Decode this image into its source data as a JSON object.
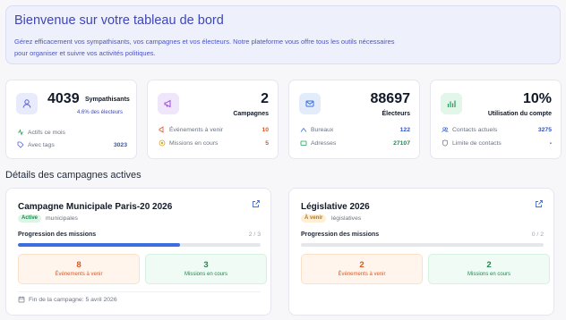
{
  "welcome": {
    "title": "Bienvenue sur votre tableau de bord",
    "description": "Gérez efficacement vos sympathisants, vos campagnes et vos électeurs. Notre plateforme vous offre tous les outils nécessaires pour organiser et suivre vos activités politiques."
  },
  "stats": {
    "supporters": {
      "value": "4039",
      "label": "Sympathisants",
      "note": "4.6% des électeurs",
      "icon": "user-icon",
      "rows": [
        {
          "label": "Actifs ce mois",
          "value": ""
        },
        {
          "label": "Avec tags",
          "value": "3023"
        }
      ]
    },
    "campaigns": {
      "value": "2",
      "label": "Campagnes",
      "icon": "megaphone-icon",
      "rows": [
        {
          "label": "Événements à venir",
          "value": "10"
        },
        {
          "label": "Missions en cours",
          "value": "5"
        }
      ]
    },
    "voters": {
      "value": "88697",
      "label": "Électeurs",
      "icon": "mail-icon",
      "rows": [
        {
          "label": "Bureaux",
          "value": "122"
        },
        {
          "label": "Adresses",
          "value": "27107"
        }
      ]
    },
    "usage": {
      "value": "10%",
      "label": "Utilisation du compte",
      "icon": "bar-chart-icon",
      "rows": [
        {
          "label": "Contacts actuels",
          "value": "3275"
        },
        {
          "label": "Limite de contacts",
          "value": "-"
        }
      ]
    }
  },
  "section_title": "Détails des campagnes actives",
  "campaigns": [
    {
      "title": "Campagne Municipale Paris-20 2026",
      "status": "Active",
      "type": "municipales",
      "progress_label": "Progression des missions",
      "progress_count": "2 / 3",
      "progress_fraction": 0.667,
      "events_value": "8",
      "events_label": "Événements à venir",
      "missions_value": "3",
      "missions_label": "Missions en cours",
      "end_label": "Fin de la campagne: 5 avril 2026"
    },
    {
      "title": "Législative 2026",
      "status": "À venir",
      "type": "législatives",
      "progress_label": "Progression des missions",
      "progress_count": "0 / 2",
      "progress_fraction": 0,
      "events_value": "2",
      "events_label": "Événements à venir",
      "missions_value": "2",
      "missions_label": "Missions en cours"
    }
  ],
  "colors": {
    "accent": "#3f46b8",
    "blue_value": "#2f54c9",
    "orange": "#e0561e",
    "green": "#1d8a4f"
  }
}
